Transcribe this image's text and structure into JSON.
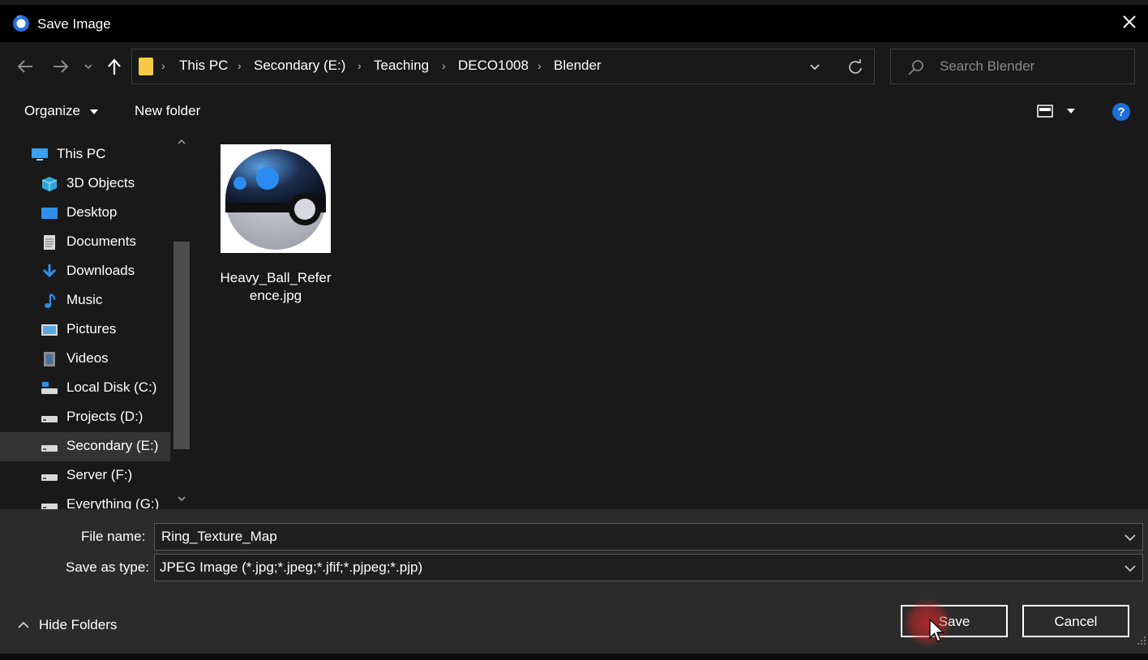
{
  "window": {
    "title": "Save Image"
  },
  "address": {
    "breadcrumbs": [
      "This PC",
      "Secondary (E:)",
      "Teaching",
      "DECO1008",
      "Blender"
    ]
  },
  "search": {
    "placeholder": "Search Blender"
  },
  "toolbar": {
    "organize_label": "Organize",
    "new_folder_label": "New folder"
  },
  "sidebar": {
    "items": [
      {
        "label": "This PC",
        "icon": "computer-icon"
      },
      {
        "label": "3D Objects",
        "icon": "cube-icon"
      },
      {
        "label": "Desktop",
        "icon": "desktop-icon"
      },
      {
        "label": "Documents",
        "icon": "document-icon"
      },
      {
        "label": "Downloads",
        "icon": "download-arrow-icon"
      },
      {
        "label": "Music",
        "icon": "music-note-icon"
      },
      {
        "label": "Pictures",
        "icon": "picture-icon"
      },
      {
        "label": "Videos",
        "icon": "film-icon"
      },
      {
        "label": "Local Disk (C:)",
        "icon": "system-drive-icon"
      },
      {
        "label": "Projects (D:)",
        "icon": "drive-icon"
      },
      {
        "label": "Secondary (E:)",
        "icon": "drive-icon",
        "selected": true
      },
      {
        "label": "Server (F:)",
        "icon": "drive-icon"
      },
      {
        "label": "Everything (G:)",
        "icon": "drive-icon"
      }
    ]
  },
  "files": [
    {
      "name": "Heavy_Ball_Reference.jpg",
      "name_line1": "Heavy_Ball_Refer",
      "name_line2": "ence.jpg"
    }
  ],
  "form": {
    "file_name_label": "File name:",
    "file_name_value": "Ring_Texture_Map",
    "save_type_label": "Save as type:",
    "save_type_value": "JPEG Image (*.jpg;*.jpeg;*.jfif;*.pjpeg;*.pjp)"
  },
  "footer": {
    "hide_folders_label": "Hide Folders",
    "save_label": "Save",
    "cancel_label": "Cancel"
  },
  "colors": {
    "folder": "#f7c948",
    "help": "#1e6fd9",
    "accent_blue": "#2a8cf0",
    "click_highlight": "#dc2828"
  }
}
